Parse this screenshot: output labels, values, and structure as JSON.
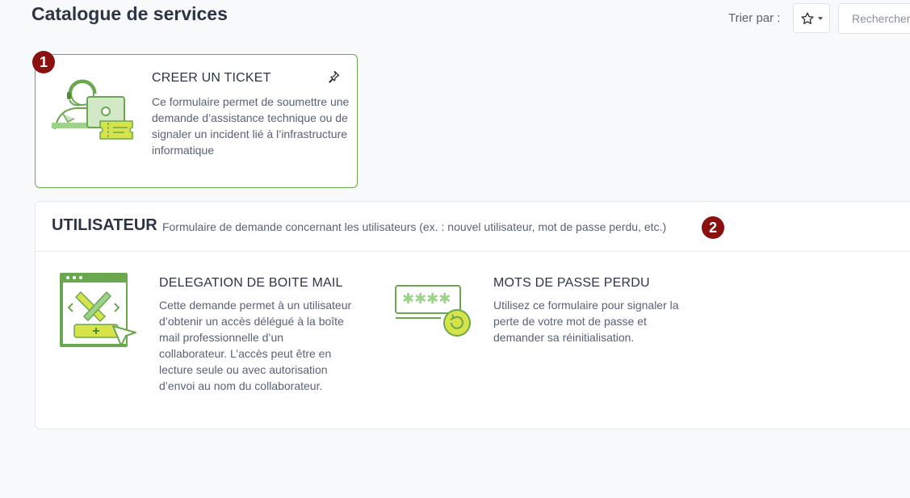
{
  "header": {
    "title": "Catalogue de services",
    "sort_label": "Trier par :",
    "sort_icon": "star-icon",
    "search_placeholder": "Rechercher"
  },
  "markers": [
    "1",
    "2"
  ],
  "featured": {
    "title": "CREER UN TICKET",
    "description": "Ce formulaire permet de soumettre une demande d’assistance technique ou de signaler un incident lié à l’infrastructure informatique",
    "pin_icon": "pin-icon",
    "illustration": "support-agent-icon"
  },
  "section": {
    "title": "UTILISATEUR",
    "description": "Formulaire de demande concernant les utilisateurs (ex. : nouvel utilisateur, mot de passe perdu, etc.)",
    "items": [
      {
        "title": "DELEGATION DE BOITE MAIL",
        "description": "Cette demande permet à un utilisateur d’obtenir un accès délégué à la boîte mail professionnelle d’un collaborateur. L’accès peut être en lecture seule ou avec autorisation d’envoi au nom du collaborateur.",
        "illustration": "design-tools-window-icon"
      },
      {
        "title": "MOTS DE PASSE PERDU",
        "description": "Utilisez ce formulaire pour signaler la perte de votre mot de passe et demander sa réinitialisation.",
        "illustration": "password-reset-icon"
      }
    ]
  },
  "colors": {
    "accent_green": "#6aa84f",
    "marker_red": "#8b1111",
    "yellow_green": "#d6e34a"
  }
}
